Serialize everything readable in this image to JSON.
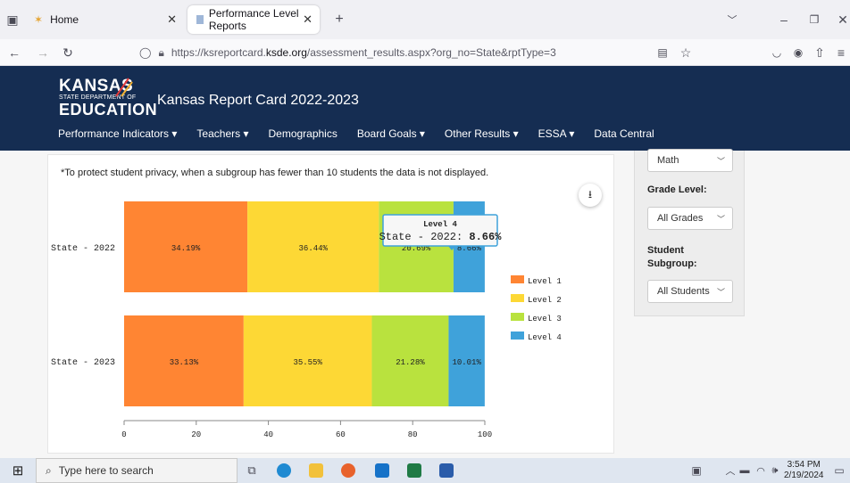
{
  "browser": {
    "tabs": [
      {
        "label": "Home"
      },
      {
        "label": "Performance Level Reports"
      }
    ],
    "new_tab": "+",
    "url_prefix": "https://ksreportcard.",
    "url_domain": "ksde.org",
    "url_suffix": "/assessment_results.aspx?org_no=State&rptType=3"
  },
  "site": {
    "logo_line1": "KANSAS",
    "logo_line2": "STATE DEPARTMENT OF",
    "logo_line3": "EDUCATION",
    "title": "Kansas Report Card 2022-2023",
    "menu": [
      "Performance Indicators ▾",
      "Teachers ▾",
      "Demographics",
      "Board Goals ▾",
      "Other Results ▾",
      "ESSA ▾",
      "Data Central"
    ]
  },
  "card": {
    "note": "*To protect student privacy, when a subgroup has fewer than 10 students the data is not displayed."
  },
  "chart_data": {
    "type": "bar",
    "orientation": "horizontal-stacked",
    "categories": [
      "State - 2022",
      "State - 2023"
    ],
    "series": [
      {
        "name": "Level 1",
        "color": "#ff8533",
        "values": [
          34.19,
          33.13
        ],
        "labels": [
          "34.19%",
          "33.13%"
        ]
      },
      {
        "name": "Level 2",
        "color": "#fdd835",
        "values": [
          36.44,
          35.55
        ],
        "labels": [
          "36.44%",
          "35.55%"
        ]
      },
      {
        "name": "Level 3",
        "color": "#b9e23e",
        "values": [
          20.69,
          21.28
        ],
        "labels": [
          "20.69%",
          "21.28%"
        ]
      },
      {
        "name": "Level 4",
        "color": "#3fa2da",
        "values": [
          8.66,
          10.01
        ],
        "labels": [
          "8.66%",
          "10.01%"
        ]
      }
    ],
    "xlim": [
      0,
      100
    ],
    "xticks": [
      "0",
      "20",
      "40",
      "60",
      "80",
      "100"
    ],
    "legend": "right",
    "tooltip": {
      "title": "Level 4",
      "prefix": "State - 2022: ",
      "value": "8.66%"
    }
  },
  "sidebar": {
    "subject_value": "Math",
    "grade_label": "Grade Level:",
    "grade_value": "All Grades",
    "subgroup_label_1": "Student",
    "subgroup_label_2": "Subgroup:",
    "subgroup_value": "All Students"
  },
  "taskbar": {
    "search_placeholder": "Type here to search",
    "time": "3:54 PM",
    "date": "2/19/2024"
  }
}
